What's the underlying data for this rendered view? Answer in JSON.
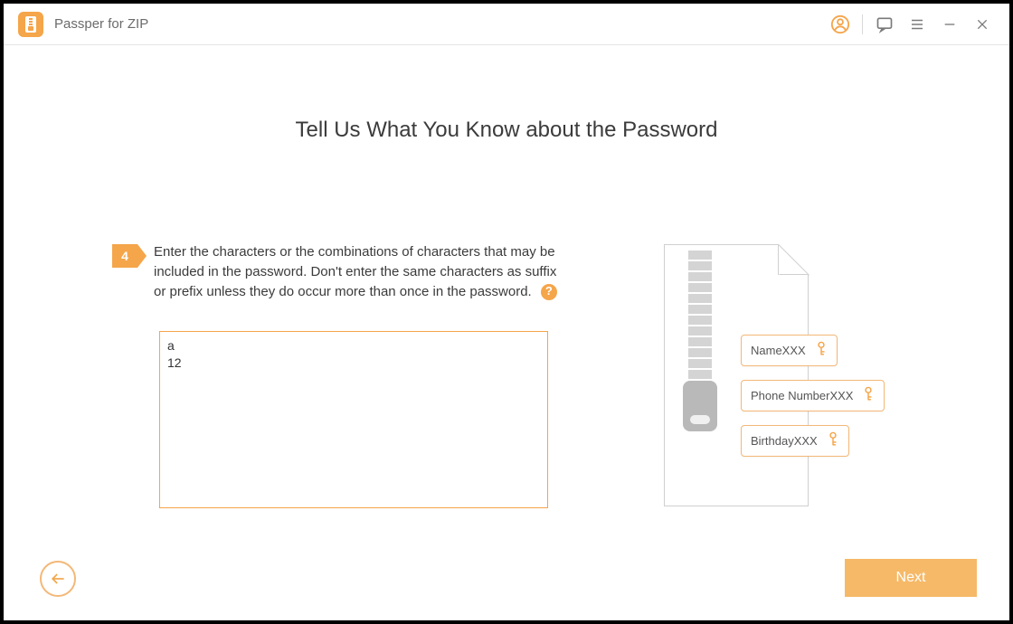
{
  "app": {
    "title": "Passper for ZIP"
  },
  "page": {
    "heading": "Tell Us What You Know about the Password",
    "step_number": "4",
    "instruction": "Enter the characters or the combinations of characters that may be included in the password. Don't enter the same characters as suffix or prefix unless they do occur more than once in the password.",
    "input_value": "a\n12"
  },
  "illustration": {
    "tags": [
      "NameXXX",
      "Phone NumberXXX",
      "BirthdayXXX"
    ]
  },
  "footer": {
    "next_label": "Next"
  }
}
